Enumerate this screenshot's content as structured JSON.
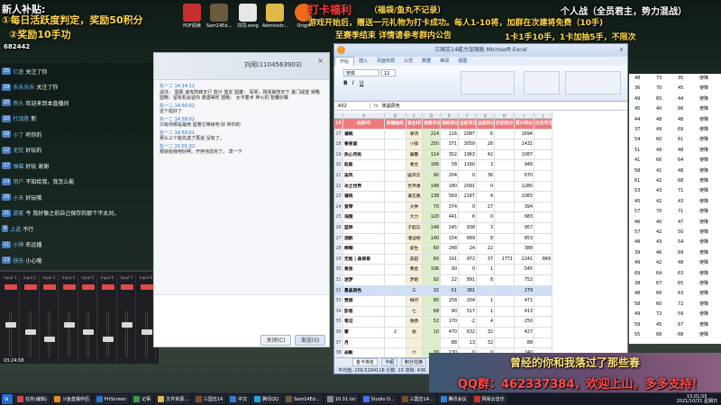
{
  "overlay": {
    "title_left": "新人补贴:",
    "line1": "①每日活跃度判定，奖励50积分",
    "line2": "②奖励10手功",
    "plus_points": "+1",
    "plus_points_2": "682442",
    "banner_title": "打卡福利",
    "banner_sub": "（福袋/鱼丸不记录）",
    "banner_mid": "游戏开始后，赠送一元礼物为打卡成功。每人1-10将，加群在次建将免费（10手)",
    "banner_mid2": "至赛季结束   详情请参考群内公告",
    "right_mode": "个人战（全员君主，势力混战）",
    "right_line2": "1卡1手10手，1卡加抽5手，不限次",
    "qq_group": "QQ群：462337384，欢迎上山。多多支持！",
    "bottom_script": "曾经的你和我落过了那些春"
  },
  "desktop_icons": [
    "PDF阅读",
    "Sam14Ed...",
    "共同.song",
    "Administr...",
    "Origin",
    "腾讯会议",
    "三国志14"
  ],
  "chat": {
    "messages": [
      {
        "badge": "15",
        "name": "亿盛",
        "text": "关注了你"
      },
      {
        "badge": "19",
        "name": "乐乐乐乐",
        "text": "关注了你"
      },
      {
        "badge": "20",
        "name": "狗头",
        "text": "欢迎来到本直播间"
      },
      {
        "badge": "10",
        "name": "打战胜",
        "text": "新"
      },
      {
        "badge": "18",
        "name": "小丁",
        "text": "听你的"
      },
      {
        "badge": "12",
        "name": "无忧",
        "text": "好玩的"
      },
      {
        "badge": "17",
        "name": "弹幕",
        "text": "好玩 谢谢"
      },
      {
        "badge": "14",
        "name": "用户",
        "text": "不知给我，我怎么能"
      },
      {
        "badge": "16",
        "name": "小天",
        "text": "好玩哦"
      },
      {
        "badge": "21",
        "name": "游客",
        "text": "今 我好像之前自己保存的那个不太对。"
      },
      {
        "badge": "9",
        "name": "上道",
        "text": "不行"
      },
      {
        "badge": "11",
        "name": "小钟",
        "text": "名远播"
      },
      {
        "badge": "13",
        "name": "快乐",
        "text": "小心哦"
      }
    ]
  },
  "mixer": {
    "label": "x10",
    "channels": [
      "Input 1",
      "Input 2",
      "Input 3",
      "Input 4",
      "Input 5",
      "Input 6",
      "Input 7",
      "Input 8"
    ],
    "time": "03:24:58"
  },
  "qq": {
    "title": "刘闹(1104563903)",
    "messages": [
      {
        "who": "东一二 14:14:12",
        "text": "战法：   盟距 速攻阵峰天行   盟计   盟友   盟雄：   军师，刚强破阵天下 夏门威望 常略   盟略：留有机会留你 遭遇等时    盟略： 太平要术 神火机 智囊妙策"
      },
      {
        "who": "东一二 14:50:02",
        "text": "这个挺好了"
      },
      {
        "who": "东一二 14:58:02",
        "text": "只有你那是最用  留着它等级吧  好    听你的"
      },
      {
        "who": "东一二 14:59:21",
        "text": "那么三个能先选了再说  没有了。"
      },
      {
        "who": "东一二 15:01:32",
        "text": "那就给我吧好啊。开序他改完了。 改一下"
      }
    ],
    "btn_close": "关闭(C)",
    "btn_send": "发送(S)"
  },
  "excel": {
    "title": "三国志14威力加强版 Microsoft Excel",
    "tabs": [
      "开始",
      "插入",
      "页面布局",
      "公式",
      "数据",
      "审阅",
      "视图"
    ],
    "font_name": "宋体",
    "font_size": "12",
    "cell_ref": "A32",
    "formula": "景晶辰色",
    "columns": [
      "玩家ID",
      "周赠抽奖",
      "君主ID",
      "消费军功",
      "消耗积分",
      "当前军功",
      "当前积分",
      "历史积分",
      "累计积分",
      "历史军功"
    ],
    "rows": [
      {
        "n": "17",
        "name": "谦碗",
        "a": "",
        "b": "尊诗",
        "c": "214",
        "d": "116",
        "e": "2087",
        "f": "6",
        "g": "",
        "h": "1694",
        "i": ""
      },
      {
        "n": "18",
        "name": "兽君鼠",
        "a": "",
        "b": "小锋",
        "c": "250",
        "d": "371",
        "e": "3059",
        "f": "26",
        "g": "",
        "h": "1431",
        "i": ""
      },
      {
        "n": "19",
        "name": "热心市民",
        "a": "",
        "b": "翼馨",
        "c": "114",
        "d": "302",
        "e": "1963",
        "f": "42",
        "g": "",
        "h": "1087",
        "i": ""
      },
      {
        "n": "20",
        "name": "赵盈",
        "a": "",
        "b": "君主",
        "c": "166",
        "d": "58",
        "e": "1160",
        "f": "3",
        "g": "",
        "h": "948",
        "i": ""
      },
      {
        "n": "21",
        "name": "宙风",
        "a": "",
        "b": "疑风云",
        "c": "90",
        "d": "204",
        "e": "0",
        "f": "36",
        "g": "",
        "h": "670",
        "i": ""
      },
      {
        "n": "22",
        "name": "冰之世界",
        "a": "",
        "b": "世界惠",
        "c": "148",
        "d": "180",
        "e": "2091",
        "f": "0",
        "g": "",
        "h": "1280",
        "i": ""
      },
      {
        "n": "23",
        "name": "谦锐",
        "a": "",
        "b": "谦瓦路",
        "c": "138",
        "d": "569",
        "e": "2167",
        "f": "4",
        "g": "",
        "h": "1083",
        "i": ""
      },
      {
        "n": "24",
        "name": "爱琴",
        "a": "",
        "b": "大钟",
        "c": "70",
        "d": "374",
        "e": "0",
        "f": "27",
        "g": "",
        "h": "394",
        "i": ""
      },
      {
        "n": "25",
        "name": "海狸",
        "a": "",
        "b": "大力",
        "c": "120",
        "d": "441",
        "e": "6",
        "f": "0",
        "g": "",
        "h": "683",
        "i": ""
      },
      {
        "n": "26",
        "name": "蓝烨",
        "a": "",
        "b": "子起忘",
        "c": "148",
        "d": "145",
        "e": "938",
        "f": "3",
        "g": "",
        "h": "957",
        "i": ""
      },
      {
        "n": "27",
        "name": "酒醉",
        "a": "",
        "b": "潘迪德",
        "c": "140",
        "d": "154",
        "e": "689",
        "f": "8",
        "g": "",
        "h": "853",
        "i": ""
      },
      {
        "n": "28",
        "name": "啊唧",
        "a": "",
        "b": "姜生",
        "c": "60",
        "d": "248",
        "e": "24",
        "f": "22",
        "g": "",
        "h": "388",
        "i": ""
      },
      {
        "n": "29",
        "name": "无敌 | 森哥哥",
        "a": "",
        "b": "森田",
        "c": "60",
        "d": "191",
        "e": "972",
        "f": "37",
        "g": "1771",
        "h": "2241",
        "i": "849"
      },
      {
        "n": "30",
        "name": "黄金",
        "a": "",
        "b": "黄金",
        "c": "106",
        "d": "90",
        "e": "0",
        "f": "1",
        "g": "",
        "h": "545",
        "i": ""
      },
      {
        "n": "31",
        "name": "迷梦",
        "a": "",
        "b": "梦姐",
        "c": "92",
        "d": "22",
        "e": "891",
        "f": "8",
        "g": "",
        "h": "752",
        "i": ""
      },
      {
        "n": "32",
        "name": "景晶辰色",
        "a": "",
        "b": "三",
        "c": "32",
        "d": "-51",
        "e": "381",
        "f": "",
        "g": "",
        "h": "279",
        "i": ""
      },
      {
        "n": "33",
        "name": "贾斌",
        "a": "",
        "b": "梅月",
        "c": "80",
        "d": "258",
        "e": "204",
        "f": "1",
        "g": "",
        "h": "471",
        "i": ""
      },
      {
        "n": "34",
        "name": "彭君",
        "a": "",
        "b": "七",
        "c": "68",
        "d": "90",
        "e": "517",
        "f": "1",
        "g": "",
        "h": "413",
        "i": ""
      },
      {
        "n": "35",
        "name": "笔记",
        "a": "",
        "b": "嘻香",
        "c": "52",
        "d": "170",
        "e": "-2",
        "f": "4",
        "g": "",
        "h": "250",
        "i": ""
      },
      {
        "n": "36",
        "name": "雷",
        "a": "2",
        "b": "魁",
        "c": "10",
        "d": "470",
        "e": "632",
        "f": "32",
        "g": "",
        "h": "427",
        "i": ""
      },
      {
        "n": "37",
        "name": "月",
        "a": "",
        "b": "",
        "c": "",
        "d": "88",
        "e": "13",
        "f": "32",
        "g": "",
        "h": "88",
        "i": ""
      },
      {
        "n": "38",
        "name": "焱敏",
        "a": "",
        "b": "六",
        "c": "30",
        "d": "130",
        "e": "0",
        "f": "0",
        "g": "",
        "h": "240",
        "i": ""
      },
      {
        "n": "39",
        "name": "人性的弱点2008",
        "a": "10",
        "b": "圣武",
        "c": "256",
        "d": "2154",
        "e": "16116",
        "f": "240",
        "g": "3924",
        "h": "7599",
        "i": "1024"
      }
    ],
    "sheets": [
      "金卡排名",
      "卡组",
      "积分兑换",
      "君主卡牌"
    ],
    "status": "平均值: 256.5294118   计数: 15   求和: 436"
  },
  "right_table": {
    "rows": [
      {
        "a": "48",
        "b": "73",
        "c": "35",
        "d": "使降"
      },
      {
        "a": "36",
        "b": "70",
        "c": "45",
        "d": "使降"
      },
      {
        "a": "49",
        "b": "65",
        "c": "44",
        "d": "使降"
      },
      {
        "a": "45",
        "b": "40",
        "c": "66",
        "d": "使降"
      },
      {
        "a": "44",
        "b": "48",
        "c": "48",
        "d": "使降"
      },
      {
        "a": "37",
        "b": "49",
        "c": "69",
        "d": "使降"
      },
      {
        "a": "54",
        "b": "60",
        "c": "61",
        "d": "使降"
      },
      {
        "a": "51",
        "b": "49",
        "c": "48",
        "d": "使降"
      },
      {
        "a": "41",
        "b": "66",
        "c": "64",
        "d": "使降"
      },
      {
        "a": "58",
        "b": "41",
        "c": "48",
        "d": "使降"
      },
      {
        "a": "61",
        "b": "42",
        "c": "68",
        "d": "使降"
      },
      {
        "a": "53",
        "b": "43",
        "c": "71",
        "d": "使降"
      },
      {
        "a": "45",
        "b": "42",
        "c": "43",
        "d": "使降"
      },
      {
        "a": "57",
        "b": "70",
        "c": "71",
        "d": "使降"
      },
      {
        "a": "46",
        "b": "40",
        "c": "47",
        "d": "使降"
      },
      {
        "a": "57",
        "b": "42",
        "c": "50",
        "d": "使降"
      },
      {
        "a": "48",
        "b": "43",
        "c": "54",
        "d": "使降"
      },
      {
        "a": "39",
        "b": "46",
        "c": "69",
        "d": "使降"
      },
      {
        "a": "49",
        "b": "42",
        "c": "48",
        "d": "使降"
      },
      {
        "a": "69",
        "b": "64",
        "c": "63",
        "d": "使降"
      },
      {
        "a": "38",
        "b": "67",
        "c": "65",
        "d": "使降"
      },
      {
        "a": "48",
        "b": "66",
        "c": "63",
        "d": "使降"
      },
      {
        "a": "58",
        "b": "60",
        "c": "72",
        "d": "使降"
      },
      {
        "a": "49",
        "b": "72",
        "c": "59",
        "d": "使降"
      },
      {
        "a": "59",
        "b": "45",
        "c": "67",
        "d": "使降"
      },
      {
        "a": "55",
        "b": "68",
        "c": "68",
        "d": "使降"
      }
    ]
  },
  "taskbar": {
    "items": [
      "任务(编辑)",
      "斗鱼直播伴侣",
      "PrtScreen",
      "记事",
      "文件资源...",
      "三国志14",
      "中文",
      "腾讯QQ",
      "Sam14Ed...",
      "10.31.txt",
      "Studio O...",
      "三国志14...",
      "腾讯会议",
      "网易云音乐"
    ],
    "clock_time": "15:01:55",
    "clock_date": "2021/10/31 星期日"
  },
  "colors": {
    "header_red": "#f07b7b",
    "green_col": "#dceec8",
    "excel_blue": "#c6d7ee",
    "overlay_red": "#ff3b3b",
    "overlay_yellow": "#ffd84a"
  }
}
